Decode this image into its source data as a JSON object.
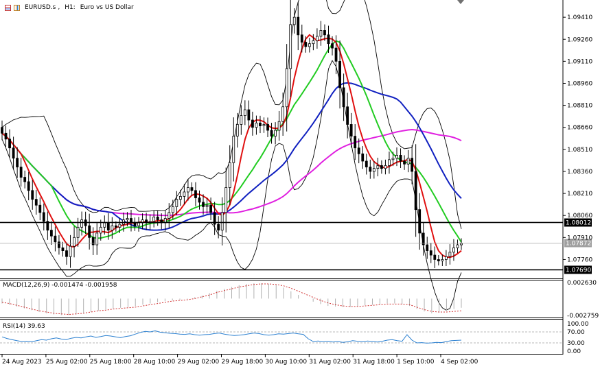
{
  "header": {
    "symbol": "EURUSD.s",
    "timeframe": "H1:",
    "description": "Euro vs US Dollar"
  },
  "indicators": {
    "macd_label": "MACD(12,26,9) -0.001474 -0.001958",
    "rsi_label": "RSI(14) 39.63"
  },
  "colors": {
    "bull": "#000000",
    "bear": "#000000",
    "ma_fast": "#e01010",
    "ma_mid": "#22cc22",
    "ma_slow": "#1020c0",
    "ma_long": "#e020e0",
    "bollinger": "#000000",
    "macd_hist": "#b0b0b0",
    "macd_signal": "#d03030",
    "rsi_line": "#2a7fd0",
    "price_tag_bg": "#000000",
    "current_tag_bg": "#a0a0a0"
  },
  "chart_data": [
    {
      "type": "candlestick",
      "symbol": "EURUSD.s",
      "timeframe": "H1",
      "y_ticks": [
        "1.09410",
        "1.09260",
        "1.09110",
        "1.08960",
        "1.08810",
        "1.08660",
        "1.08510",
        "1.08360",
        "1.08210",
        "1.08060",
        "1.07910",
        "1.07760"
      ],
      "ylim": [
        1.0765,
        1.0949
      ],
      "x_ticks": [
        "24 Aug 2023",
        "25 Aug 02:00",
        "25 Aug 18:00",
        "28 Aug 10:00",
        "29 Aug 02:00",
        "29 Aug 18:00",
        "30 Aug 10:00",
        "31 Aug 02:00",
        "31 Aug 18:00",
        "1 Sep 10:00",
        "4 Sep 02:00"
      ],
      "price_levels": [
        {
          "label": "1.08012",
          "value": 1.08012,
          "style": "horizontal-line"
        },
        {
          "label": "1.07690",
          "value": 1.0769,
          "style": "horizontal-line"
        },
        {
          "label": "1.07872",
          "value": 1.07872,
          "style": "current-price"
        }
      ],
      "closes": [
        1.0862,
        1.0858,
        1.0852,
        1.0845,
        1.0839,
        1.0832,
        1.0829,
        1.0823,
        1.0817,
        1.0813,
        1.0808,
        1.0802,
        1.0796,
        1.0792,
        1.0788,
        1.0784,
        1.0782,
        1.0778,
        1.0785,
        1.0791,
        1.0798,
        1.0803,
        1.0799,
        1.0791,
        1.0786,
        1.0794,
        1.0798,
        1.0801,
        1.0796,
        1.0799,
        1.0798,
        1.08,
        1.0803,
        1.0804,
        1.0801,
        1.0799,
        1.0801,
        1.0803,
        1.0801,
        1.0802,
        1.0805,
        1.0803,
        1.0801,
        1.0804,
        1.0808,
        1.0812,
        1.0817,
        1.0819,
        1.0822,
        1.0825,
        1.0823,
        1.0818,
        1.0815,
        1.0812,
        1.0813,
        1.0808,
        1.08,
        1.0796,
        1.0808,
        1.0825,
        1.0842,
        1.086,
        1.0868,
        1.0874,
        1.0878,
        1.0871,
        1.0866,
        1.0869,
        1.0867,
        1.0868,
        1.0864,
        1.086,
        1.0864,
        1.087,
        1.088,
        1.0906,
        1.0936,
        1.0941,
        1.0929,
        1.0924,
        1.0921,
        1.0923,
        1.0925,
        1.0928,
        1.0932,
        1.0929,
        1.0923,
        1.092,
        1.0911,
        1.0893,
        1.088,
        1.0868,
        1.086,
        1.0852,
        1.0848,
        1.0843,
        1.0839,
        1.0836,
        1.0838,
        1.084,
        1.0838,
        1.084,
        1.0844,
        1.0845,
        1.0847,
        1.0843,
        1.0841,
        1.0845,
        1.0836,
        1.081,
        1.0794,
        1.0786,
        1.0782,
        1.0779,
        1.0776,
        1.0775,
        1.0776,
        1.0778,
        1.0781,
        1.0784,
        1.0786,
        1.0787
      ],
      "indicators": [
        "Moving averages (red, green, blue, magenta)",
        "Bollinger Bands (black)"
      ]
    },
    {
      "type": "bar",
      "name": "MACD(12,26,9)",
      "values_text": "-0.001474 -0.001958",
      "y_ticks": [
        "0.002630",
        "-0.002759"
      ],
      "ylim": [
        -0.002759,
        0.00263
      ],
      "series": [
        {
          "name": "main",
          "kind": "histogram",
          "values": [
            -0.0008,
            -0.001,
            -0.0013,
            -0.0016,
            -0.0019,
            -0.0022,
            -0.0024,
            -0.0026,
            -0.0027,
            -0.0027,
            -0.0026,
            -0.0024,
            -0.0022,
            -0.002,
            -0.0018,
            -0.0016,
            -0.0015,
            -0.0014,
            -0.0012,
            -0.001,
            -0.0008,
            -0.0006,
            -0.0004,
            -0.0003,
            -0.0002,
            -0.0001,
            0.0002,
            0.0005,
            0.0009,
            0.0013,
            0.0016,
            0.0019,
            0.0022,
            0.0024,
            0.0025,
            0.0025,
            0.0024,
            0.0022,
            0.0018,
            0.0012,
            0.0006,
            0.0,
            -0.0005,
            -0.0009,
            -0.0012,
            -0.0013,
            -0.0014,
            -0.0014,
            -0.0013,
            -0.0011,
            -0.001,
            -0.0009,
            -0.0008,
            -0.0008,
            -0.0009,
            -0.0012,
            -0.0017,
            -0.0021,
            -0.0024,
            -0.0023,
            -0.002,
            -0.0017,
            -0.0015
          ]
        },
        {
          "name": "signal",
          "kind": "line",
          "values": [
            -0.0006,
            -0.0008,
            -0.0011,
            -0.0014,
            -0.0017,
            -0.002,
            -0.0022,
            -0.0024,
            -0.0025,
            -0.0026,
            -0.0025,
            -0.0024,
            -0.0022,
            -0.002,
            -0.0019,
            -0.0017,
            -0.0016,
            -0.0015,
            -0.0014,
            -0.0012,
            -0.001,
            -0.0008,
            -0.0006,
            -0.0004,
            -0.0003,
            -0.0002,
            0.0,
            0.0003,
            0.0006,
            0.001,
            0.0013,
            0.0016,
            0.0019,
            0.0021,
            0.0023,
            0.0024,
            0.0024,
            0.0023,
            0.0021,
            0.0017,
            0.0012,
            0.0007,
            0.0002,
            -0.0003,
            -0.0007,
            -0.001,
            -0.0012,
            -0.0013,
            -0.0013,
            -0.0012,
            -0.0011,
            -0.001,
            -0.0009,
            -0.0009,
            -0.0009,
            -0.001,
            -0.0014,
            -0.0018,
            -0.0021,
            -0.0022,
            -0.0022,
            -0.0021,
            -0.002
          ]
        }
      ]
    },
    {
      "type": "line",
      "name": "RSI(14)",
      "values_text": "39.63",
      "y_ticks": [
        "100.00",
        "70.00",
        "30.00",
        "0.00"
      ],
      "levels": [
        70,
        30
      ],
      "ylim": [
        0,
        100
      ],
      "series": [
        {
          "name": "RSI",
          "values": [
            52,
            46,
            42,
            38,
            35,
            36,
            34,
            38,
            42,
            40,
            45,
            48,
            44,
            42,
            47,
            50,
            48,
            52,
            55,
            50,
            53,
            57,
            55,
            52,
            49,
            53,
            56,
            62,
            68,
            72,
            70,
            74,
            69,
            67,
            65,
            64,
            62,
            61,
            63,
            60,
            58,
            60,
            61,
            64,
            66,
            62,
            59,
            57,
            58,
            60,
            63,
            66,
            64,
            60,
            58,
            60,
            63,
            62,
            64,
            66,
            63,
            61,
            45,
            35,
            37,
            34,
            36,
            33,
            35,
            32,
            34,
            38,
            36,
            34,
            37,
            35,
            33,
            36,
            40,
            42,
            38,
            36,
            60,
            40,
            30,
            31,
            29,
            30,
            32,
            31,
            35,
            38,
            39,
            40
          ]
        }
      ]
    }
  ]
}
